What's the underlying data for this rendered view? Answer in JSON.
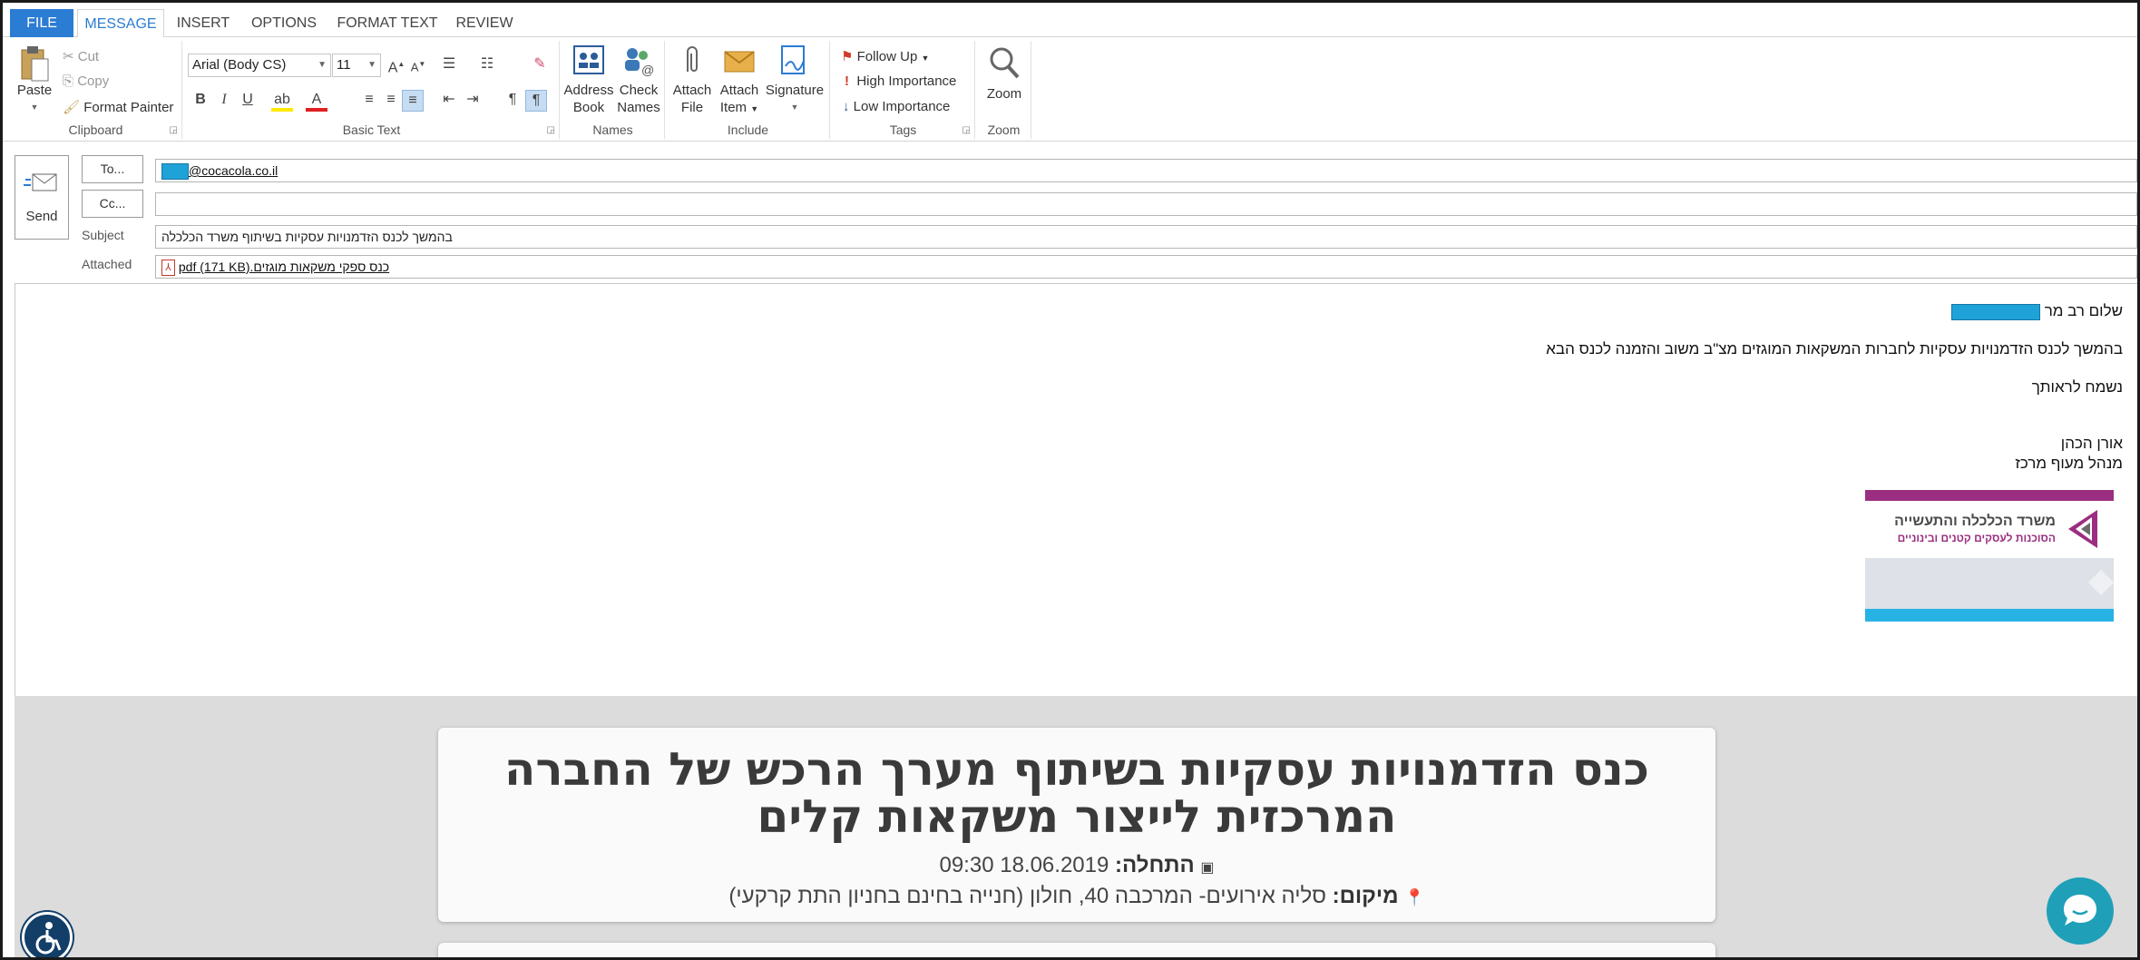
{
  "tabs": [
    "FILE",
    "MESSAGE",
    "INSERT",
    "OPTIONS",
    "FORMAT TEXT",
    "REVIEW"
  ],
  "ribbon": {
    "clipboard": {
      "label": "Clipboard",
      "paste": "Paste",
      "cut": "Cut",
      "copy": "Copy",
      "format_painter": "Format Painter"
    },
    "basic_text": {
      "label": "Basic Text",
      "font": "Arial (Body CS)",
      "size": "11",
      "bold": "B",
      "italic": "I",
      "underline": "U"
    },
    "names": {
      "label": "Names",
      "address_book_1": "Address",
      "address_book_2": "Book",
      "check_names_1": "Check",
      "check_names_2": "Names"
    },
    "include": {
      "label": "Include",
      "attach_file_1": "Attach",
      "attach_file_2": "File",
      "attach_item_1": "Attach",
      "attach_item_2": "Item",
      "signature": "Signature"
    },
    "tags": {
      "label": "Tags",
      "follow_up": "Follow Up",
      "high": "High Importance",
      "low": "Low Importance"
    },
    "zoom": {
      "label": "Zoom",
      "zoom": "Zoom"
    }
  },
  "header": {
    "send": "Send",
    "to_button": "To...",
    "cc_button": "Cc...",
    "to_value": "@cocacola.co.il",
    "subject_label": "Subject",
    "subject_value": "בהמשך לכנס הזדמנויות עסקיות בשיתוף משרד הכלכלה",
    "attached_label": "Attached",
    "attachment": "כנס ספקי משקאות מוגזים.pdf (171 KB)"
  },
  "body": {
    "greeting": "שלום רב מר",
    "line1": "בהמשך לכנס הזדמנויות עסקיות לחברות המשקאות המוגזים מצ\"ב משוב והזמנה לכנס הבא",
    "line2": "נשמח לראותך",
    "sig_name": "אורן הכהן",
    "sig_title": "מנהל מעוף מרכז",
    "logo_line1": "משרד הכלכלה והתעשייה",
    "logo_line2": "הסוכנות לעסקים קטנים ובינוניים"
  },
  "webpage": {
    "title_line1": "כנס הזדמנויות עסקיות בשיתוף מערך הרכש של החברה",
    "title_line2": "המרכזית לייצור משקאות קלים",
    "start_label": "התחלה:",
    "start_value": "18.06.2019 09:30",
    "location_label": "מיקום:",
    "location_value": "סליה אירועים- המרכבה 40, חולון (חנייה בחינם בחניון התת קרקעי)"
  },
  "colors": {
    "accent": "#2b7cd3",
    "mask": "#1fa2d8",
    "logo_purple": "#9b2e80",
    "chat": "#1fa0b8",
    "access": "#123e68"
  }
}
